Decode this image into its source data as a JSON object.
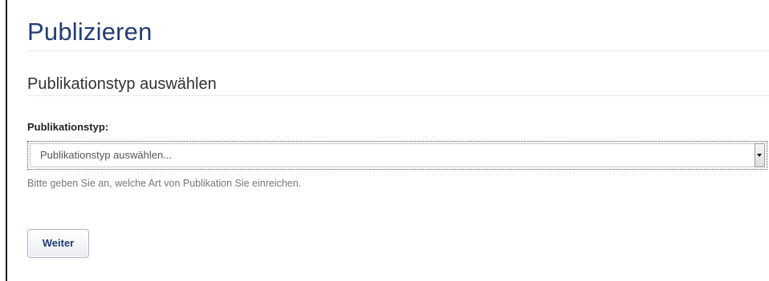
{
  "page": {
    "title": "Publizieren"
  },
  "section": {
    "heading": "Publikationstyp auswählen"
  },
  "form": {
    "publication_type": {
      "label": "Publikationstyp:",
      "selected_value": "Publikationstyp auswählen...",
      "help_text": "Bitte geben Sie an, welche Art von Publikation Sie einreichen."
    },
    "next_button_label": "Weiter"
  },
  "colors": {
    "title": "#233d73",
    "frame_border": "#1a1a1a",
    "help_text": "#777777"
  }
}
